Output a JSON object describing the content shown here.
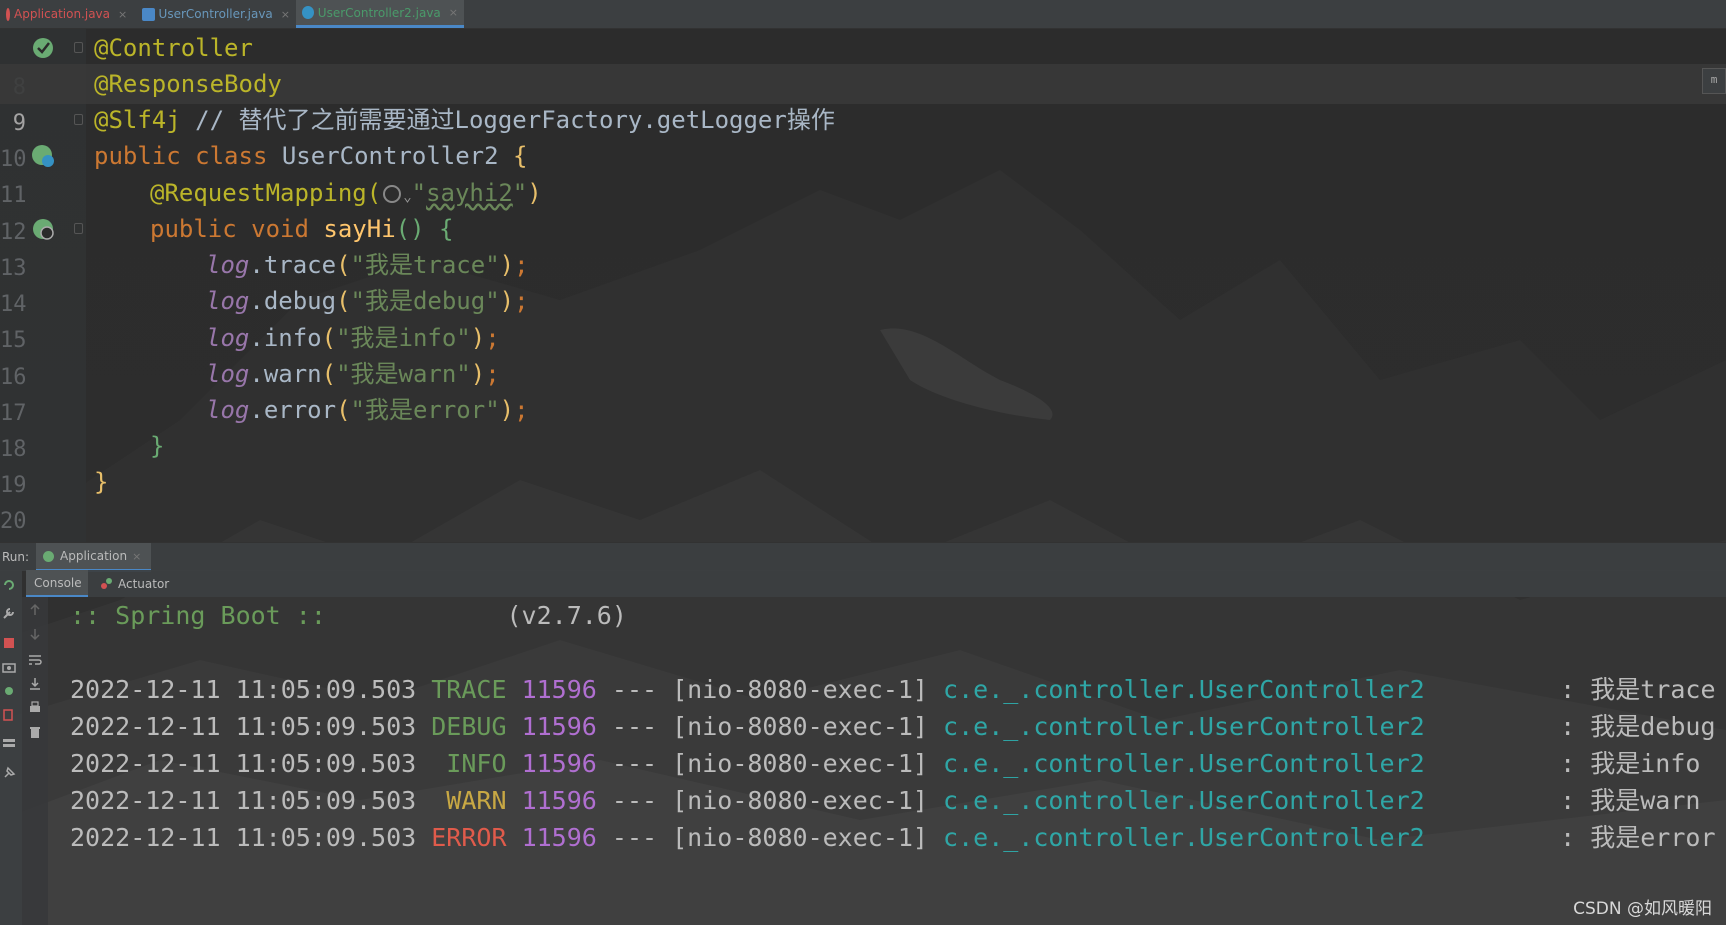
{
  "tabs": [
    {
      "label": "Application.java",
      "color": "#d25252",
      "icon": "spring-class-icon",
      "active": false
    },
    {
      "label": "UserController.java",
      "color": "#6897bb",
      "icon": "class-icon",
      "active": false
    },
    {
      "label": "UserController2.java",
      "color": "#4a9a6a",
      "icon": "class-icon",
      "active": true
    }
  ],
  "editor": {
    "line_numbers": [
      "8",
      "9",
      "10",
      "11",
      "12",
      "13",
      "14",
      "15",
      "16",
      "17",
      "18",
      "19",
      "20"
    ],
    "l8": "@Controller",
    "l9": "@ResponseBody",
    "l10_ann": "@Slf4j",
    "l10_comment": "// 替代了之前需要通过LoggerFactory.getLogger操作",
    "l11_kw": "public class",
    "l11_name": "UserController2",
    "l11_brace": "{",
    "l12_ann": "@RequestMapping(",
    "l12_url": "sayhi2",
    "l12_close": ")",
    "l13_kw": "public void",
    "l13_fn": "sayHi",
    "l13_rest": "() {",
    "log_field": "log",
    "calls": [
      {
        "method": "trace",
        "msg": "\"我是trace\""
      },
      {
        "method": "debug",
        "msg": "\"我是debug\""
      },
      {
        "method": "info",
        "msg": "\"我是info\""
      },
      {
        "method": "warn",
        "msg": "\"我是warn\""
      },
      {
        "method": "error",
        "msg": "\"我是error\""
      }
    ],
    "l19": "}",
    "l20": "}",
    "marker": "m"
  },
  "run": {
    "label": "Run:",
    "app_tab": "Application",
    "console_tab": "Console",
    "actuator_tab": "Actuator"
  },
  "console": {
    "banner_left": ":: Spring Boot ::",
    "banner_version": "(v2.7.6)",
    "logs": [
      {
        "ts": "2022-12-11 11:05:09.503",
        "level": "TRACE",
        "pid": "11596",
        "thread": "--- [nio-8080-exec-1]",
        "logger": "c.e._.controller.UserController2",
        "msg": ": 我是trace"
      },
      {
        "ts": "2022-12-11 11:05:09.503",
        "level": "DEBUG",
        "pid": "11596",
        "thread": "--- [nio-8080-exec-1]",
        "logger": "c.e._.controller.UserController2",
        "msg": ": 我是debug"
      },
      {
        "ts": "2022-12-11 11:05:09.503",
        "level": " INFO",
        "pid": "11596",
        "thread": "--- [nio-8080-exec-1]",
        "logger": "c.e._.controller.UserController2",
        "msg": ": 我是info"
      },
      {
        "ts": "2022-12-11 11:05:09.503",
        "level": " WARN",
        "pid": "11596",
        "thread": "--- [nio-8080-exec-1]",
        "logger": "c.e._.controller.UserController2",
        "msg": ": 我是warn"
      },
      {
        "ts": "2022-12-11 11:05:09.503",
        "level": "ERROR",
        "pid": "11596",
        "thread": "--- [nio-8080-exec-1]",
        "logger": "c.e._.controller.UserController2",
        "msg": ": 我是error"
      }
    ]
  },
  "watermark": "CSDN @如风暖阳"
}
